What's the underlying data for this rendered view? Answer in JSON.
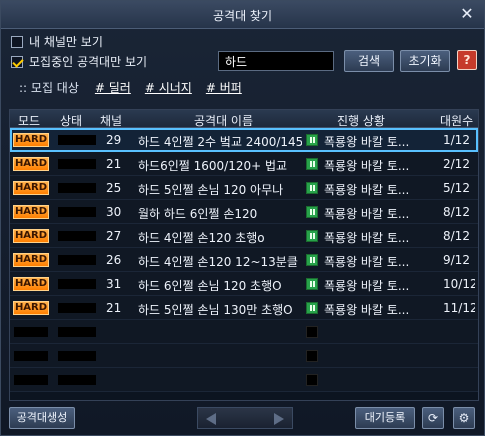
{
  "window": {
    "title": "공격대 찾기"
  },
  "filters": {
    "only_channel_label": "내 채널만 보기",
    "only_recruiting_label": "모집중인 공격대만 보기",
    "only_channel_checked": false,
    "only_recruiting_checked": true
  },
  "search": {
    "value": "하드",
    "search_button": "검색",
    "reset_button": "초기화"
  },
  "tags": {
    "label": ":: 모집 대상",
    "items": [
      "# 딜러",
      "# 시너지",
      "# 버퍼"
    ]
  },
  "table": {
    "headers": [
      "모드",
      "상태",
      "채널",
      "공격대 이름",
      "진행 상황",
      "대원수"
    ],
    "rows": [
      {
        "mode": "HARD",
        "channel": "29",
        "name": "하드 4인쩔 2수 벜교 2400/145",
        "progress": "폭룡왕 바칼 토...",
        "members": "1/12",
        "selected": true
      },
      {
        "mode": "HARD",
        "channel": "21",
        "name": "하드6인쩔 1600/120+ 법교",
        "progress": "폭룡왕 바칼 토...",
        "members": "2/12",
        "selected": false
      },
      {
        "mode": "HARD",
        "channel": "25",
        "name": "하드 5인쩔 손님 120 아무나",
        "progress": "폭룡왕 바칼 토...",
        "members": "5/12",
        "selected": false
      },
      {
        "mode": "HARD",
        "channel": "30",
        "name": "월하 하드 6인쩔 손120",
        "progress": "폭룡왕 바칼 토...",
        "members": "8/12",
        "selected": false
      },
      {
        "mode": "HARD",
        "channel": "27",
        "name": "하드 4인쩔 손120 초행o",
        "progress": "폭룡왕 바칼 토...",
        "members": "8/12",
        "selected": false
      },
      {
        "mode": "HARD",
        "channel": "26",
        "name": "하드 4인쩔 손120 12~13분클",
        "progress": "폭룡왕 바칼 토...",
        "members": "9/12",
        "selected": false
      },
      {
        "mode": "HARD",
        "channel": "31",
        "name": "하드 6인쩔 손님 120 초행O",
        "progress": "폭룡왕 바칼 토...",
        "members": "10/12",
        "selected": false
      },
      {
        "mode": "HARD",
        "channel": "21",
        "name": "하드 5인쩔 손님 130만 초행O",
        "progress": "폭룡왕 바칼 토...",
        "members": "11/12",
        "selected": false
      }
    ],
    "empty_rows": 3
  },
  "footer": {
    "create_button": "공격대생성",
    "wait_button": "대기등록"
  },
  "icons": {
    "close": "close-icon",
    "book": "book-icon",
    "refresh": "refresh-icon",
    "settings": "gear-icon",
    "progress": "progress-icon"
  }
}
